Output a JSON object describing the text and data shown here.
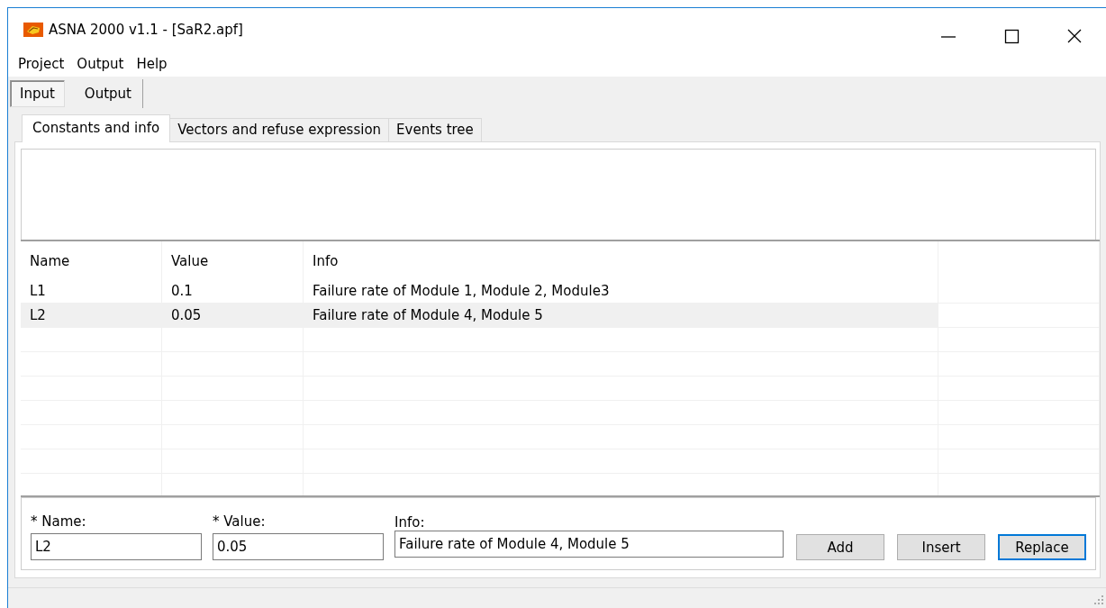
{
  "window": {
    "title": "ASNA 2000 v1.1 - [SaR2.apf]"
  },
  "menu": [
    "Project",
    "Output",
    "Help"
  ],
  "mode_buttons": [
    {
      "label": "Input",
      "selected": true
    },
    {
      "label": "Output",
      "selected": false
    }
  ],
  "tabs": [
    {
      "label": "Constants and info",
      "selected": true
    },
    {
      "label": "Vectors and refuse expression",
      "selected": false
    },
    {
      "label": "Events tree",
      "selected": false
    }
  ],
  "table": {
    "columns": [
      "Name",
      "Value",
      "Info"
    ],
    "rows": [
      {
        "cells": [
          "L1",
          "0.1",
          "Failure rate of Module 1, Module 2, Module3"
        ],
        "selected": false
      },
      {
        "cells": [
          "L2",
          "0.05",
          "Failure rate of Module 4, Module 5"
        ],
        "selected": true
      }
    ]
  },
  "form": {
    "fields": [
      {
        "label": "* Name:",
        "value": "L2"
      },
      {
        "label": "* Value:",
        "value": "0.05"
      },
      {
        "label": "Info:",
        "value": "Failure rate of Module 4, Module 5"
      }
    ],
    "buttons": [
      {
        "label": "Add",
        "focused": false
      },
      {
        "label": "Insert",
        "focused": false
      },
      {
        "label": "Replace",
        "focused": true
      }
    ]
  }
}
